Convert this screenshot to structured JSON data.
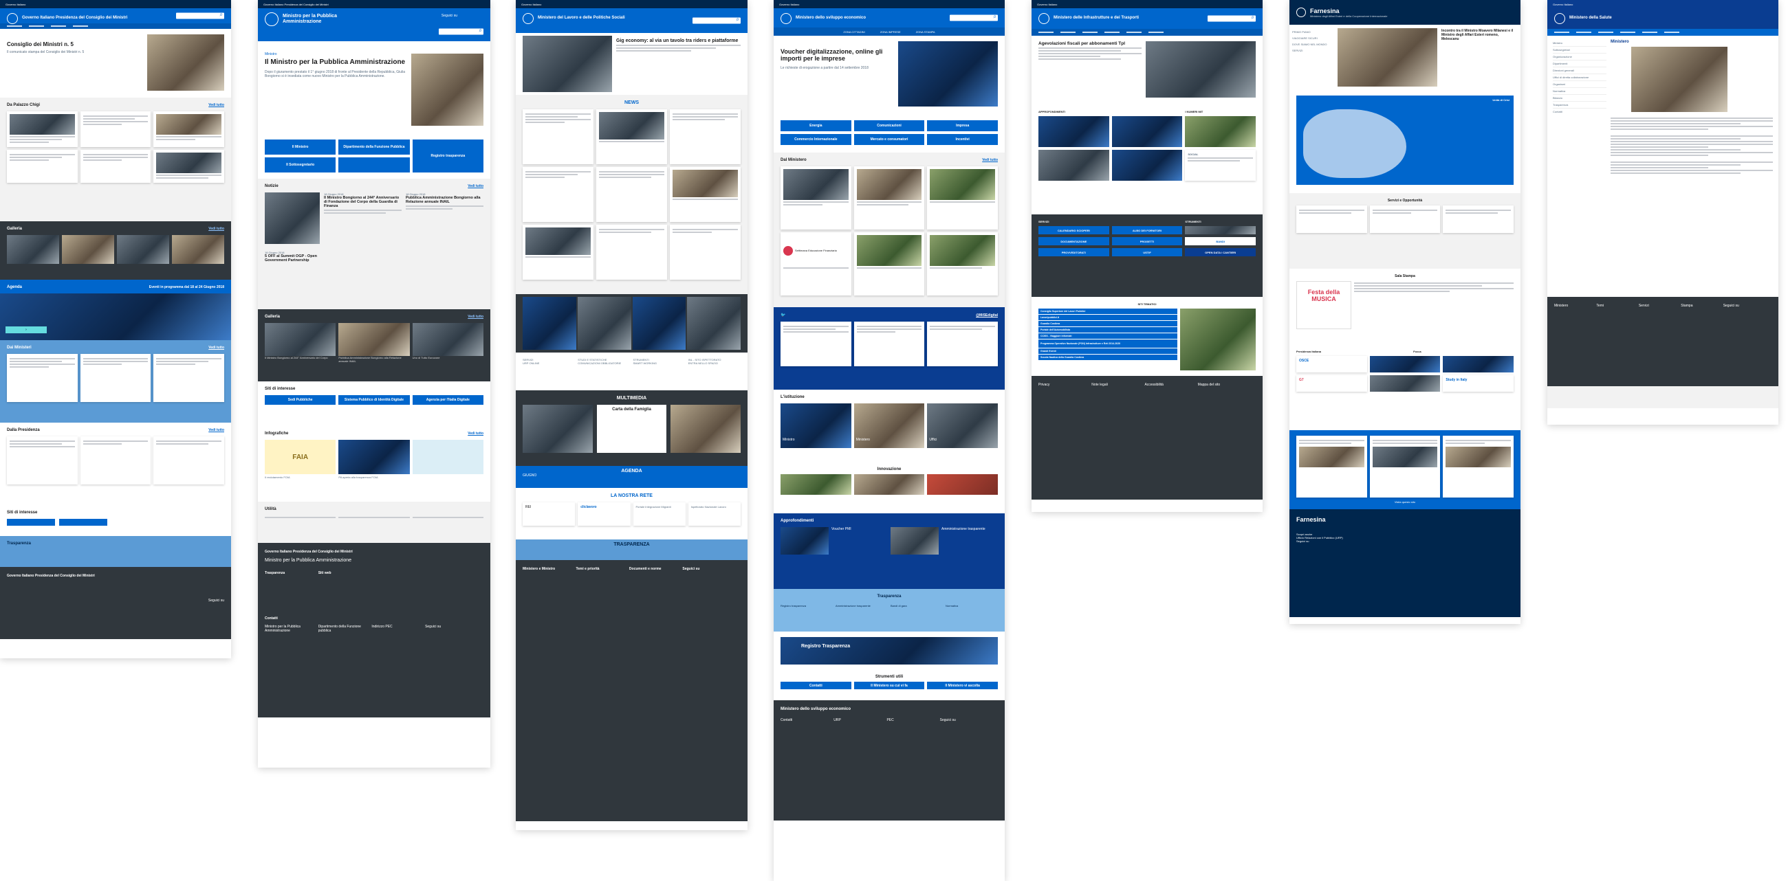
{
  "sheets": [
    {
      "id": "governo",
      "top_bar": "Governo Italiano",
      "brand": "Governo Italiano Presidenza del Consiglio dei Ministri",
      "hero_title": "Consiglio dei Ministri n. 5",
      "hero_text": "Il comunicato stampa del Consiglio dei Ministri n. 5",
      "sections": [
        "Da Palazzo Chigi",
        "Galleria",
        "Agenda",
        "Dai Ministeri",
        "Dalla Presidenza",
        "Siti di interesse",
        "Trasparenza"
      ],
      "see_all": "Vedi tutto",
      "agenda_caption": "Eventi in programma dal 18 al 24 Giugno 2018",
      "footer_brand": "Governo Italiano Presidenza del Consiglio dei Ministri",
      "footer_follow": "Seguici su"
    },
    {
      "id": "funzione-pubblica",
      "top_bar": "Governo Italiano   Presidenza del Consiglio dei Ministri",
      "brand": "Ministro per la Pubblica Amministrazione",
      "search_label": "Seguici su",
      "hero_kicker": "Ministro",
      "hero_title": "Il Ministro per la Pubblica Amministrazione",
      "hero_text": "Dopo il giuramento prestato il 1° giugno 2018 di fronte al Presidente della Repubblica, Giulia Bongiorno si è insediata come nuovo Ministro per la Pubblica Amministrazione.",
      "tiles": [
        "Il Ministro",
        "Dipartimento della Funzione Pubblica",
        "Registro trasparenza",
        "Il Sottosegretario"
      ],
      "news_title": "Notizie",
      "news": [
        {
          "date": "18 Giugno 2018",
          "title": "Il Ministro Bongiorno al 244° Anniversario di Fondazione del Corpo della Guardia di Finanza"
        },
        {
          "date": "18 Giugno 2018",
          "title": "Pubblica Amministrazione Bongiorno alla Relazione annuale INAIL"
        },
        {
          "date": "18 Giugno 2018",
          "title": "5 OFF al Summit OGP - Open Government Partnership"
        }
      ],
      "gallery_title": "Galleria",
      "gallery_captions": [
        "Il Ministro Bongiorno al 244° Anniversario del Corpo",
        "Pubblica Amministrazione Bongiorno alla Relazione annuale INAIL",
        "Uno di Tutto Eurozone"
      ],
      "sites_title": "Siti di interesse",
      "sites": [
        "Sedi Pubbliche",
        "Sistema Pubblico di Identità Digitale",
        "Agenzia per l'Italia Digitale"
      ],
      "info_title": "Infografiche",
      "info_captions": [
        "FAIA",
        "Il reclutamento FOIA",
        "PA aperta alla trasparenza FOIA"
      ],
      "utility_title": "Utilità",
      "footer_brand": "Governo Italiano Presidenza del Consiglio dei Ministri",
      "footer_sub": "Ministro per la Pubblica Amministrazione",
      "footer_cols": [
        "Trasparenza",
        "Siti web"
      ],
      "contacts_title": "Contatti",
      "contacts": [
        "Ministro per la Pubblica Amministrazione",
        "Dipartimento della Funzione pubblica",
        "Indirizzo PEC"
      ],
      "footer_follow": "Seguici su",
      "see_all": "Vedi tutto"
    },
    {
      "id": "lavoro",
      "top_bar": "Governo Italiano",
      "brand": "Ministero del Lavoro e delle Politiche Sociali",
      "hero_title": "Gig economy: al via un tavolo tra riders e piattaforme",
      "news_title": "NEWS",
      "multimedia_title": "MULTIMEDIA",
      "multimedia_caption": "Carta della Famiglia",
      "agenda_title": "AGENDA",
      "agenda_month": "GIUGNO",
      "network_title": "LA NOSTRA RETE",
      "network_items": [
        "REI",
        "cliclavoro",
        "Portale Integrazione Migranti",
        "Ispettorato Nazionale Lavoro"
      ],
      "transparency_title": "TRASPARENZA",
      "strip_labels": [
        "SERVIZI",
        "STUDI E STATISTICHE",
        "STRUMENTI",
        "INL - SITO ISPETTORATO"
      ],
      "strip_items": [
        "URP ONLINE",
        "COMUNICAZIONI OBBLIGATORIE",
        "SMART WORKING",
        "ENTRA NELLO SPAZIO"
      ],
      "footer_cols": [
        "Ministero e Ministro",
        "Temi e priorità",
        "Documenti e norme",
        "Seguici su"
      ]
    },
    {
      "id": "mise",
      "top_bar": "Governo Italiano",
      "brand": "Ministero dello sviluppo economico",
      "nav": [
        "ZONA CITTADINI",
        "ZONA IMPRESE",
        "ZONA STAMPA"
      ],
      "hero_title": "Voucher digitalizzazione, online gli importi per le imprese",
      "hero_text": "Le richieste di erogazione a partire dal 14 settembre 2018",
      "tiles": [
        "Energia",
        "Comunicazioni",
        "Impresa",
        "Commercio Internazionale",
        "Mercato e consumatori",
        "Incentivi"
      ],
      "ministry_title": "Dal Ministero",
      "ministry_logo": "Settimana Educazione Finanziaria",
      "see_all": "Vedi tutto",
      "twitter_handle": "@MiSEdigital",
      "institution_title": "L'istituzione",
      "institution_items": [
        "Ministro",
        "Ministero",
        "Uffici"
      ],
      "innovation_title": "Innovazione",
      "insights_title": "Approfondimenti",
      "insights_items": [
        "Voucher PMI",
        "Amministrazione trasparente"
      ],
      "transparency_title": "Trasparenza",
      "transparency_links": [
        "Registro trasparenza",
        "Amministrazione trasparente",
        "Bandi di gara",
        "Normativa"
      ],
      "register_title": "Registro Trasparenza",
      "tools_title": "Strumenti utili",
      "tools": [
        "Contatti",
        "Il Ministero su cui vi fa",
        "Il Ministero vi ascolta"
      ],
      "footer_brand": "Ministero dello sviluppo economico",
      "footer_cols": [
        "Contatti",
        "URP",
        "PEC",
        "Seguici su"
      ]
    },
    {
      "id": "mit",
      "top_bar": "Governo Italiano",
      "brand": "Ministero delle Infrastrutture e dei Trasporti",
      "hero_title": "Agevolazioni fiscali per abbonamenti Tpl",
      "sections": [
        "APPROFONDIMENTI",
        "I NUMERI MIT",
        "SOCIAL",
        "SERVIZI",
        "STRUMENTI",
        "IN EVIDENZA",
        "UFFICI TERRITORIALI",
        "SITI TEMATICI"
      ],
      "services": [
        "CALENDARIO SCIOPERI",
        "ALBO DEI FORNITORI",
        "PROGETTI",
        "DOCUMENTAZIONE",
        "BANDI",
        "PROVVEDITORATI",
        "USTIF",
        "OPEN DATA / CANTIERI"
      ],
      "theme_sites": [
        "Consiglio Superiore dei Lavori Pubblici",
        "Lavoripubblici.it",
        "Guardia Costiera",
        "Portale dell'Automobilista",
        "CCISS - Viaggiare informati",
        "Programma Operativo Nazionale (PON) Infrastrutture e Reti 2014-2020",
        "Grandi Eventi",
        "Scuola Nautica della Guardia Costiera",
        "Sistema Controlli Pubblici"
      ],
      "footer_links": [
        "Privacy",
        "Note legali",
        "Accessibilità",
        "Mappa del sito"
      ]
    },
    {
      "id": "farnesina",
      "brand": "Farnesina",
      "brand_sub": "Ministero degli Affari Esteri e della Cooperazione Internazionale",
      "left_nav": [
        "PRIMO PIANO",
        "VIAGGIARE SICURI",
        "DOVE SIAMO NEL MONDO",
        "SERVIZI"
      ],
      "hero_title": "Incontro tra il Ministro Moavero Milanesi e il Ministro degli Affari Esteri romeno, Melescanu",
      "map_title": "Unità di Crisi",
      "services_title": "Servizi e Opportunità",
      "press_title": "Sala Stampa",
      "festival_title": "Festa della MUSICA",
      "presidency_title": "Presidenza italiana",
      "focus_title": "Focus",
      "focus_items": [
        "OSCE",
        "G7",
        "Study in Italy"
      ],
      "social_title": "Visita questo sito",
      "footer_brand": "Farnesina",
      "footer_cols": [
        "Scopri anche",
        "Ufficio Relazioni con il Pubblico (URP)",
        "Seguici su"
      ]
    },
    {
      "id": "ministero-generico",
      "top_bar": "Governo Italiano",
      "brand": "Ministero della Salute",
      "page_title": "Ministero",
      "side_items": [
        "Ministro",
        "Sottosegretari",
        "Organizzazione",
        "Dipartimenti",
        "Direzioni generali",
        "Uffici di diretta collaborazione",
        "Organismi",
        "Normativa",
        "Bilancio",
        "Trasparenza",
        "Contatti"
      ],
      "footer_cols": [
        "Ministero",
        "Temi",
        "Servizi",
        "Stampa",
        "Seguici su"
      ]
    }
  ]
}
